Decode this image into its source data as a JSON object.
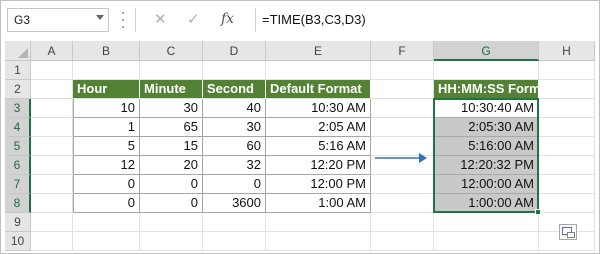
{
  "namebox": {
    "value": "G3"
  },
  "formula_bar": {
    "cancel_icon": "x-icon",
    "enter_icon": "check-icon",
    "fx_label": "fx",
    "formula": "=TIME(B3,C3,D3)"
  },
  "columns": [
    "A",
    "B",
    "C",
    "D",
    "E",
    "F",
    "G",
    "H"
  ],
  "rows": [
    "1",
    "2",
    "3",
    "4",
    "5",
    "6",
    "7",
    "8",
    "9",
    "10"
  ],
  "table1": {
    "headers": [
      "Hour",
      "Minute",
      "Second",
      "Default Format"
    ],
    "rows": [
      [
        "10",
        "30",
        "40",
        "10:30 AM"
      ],
      [
        "1",
        "65",
        "30",
        "2:05 AM"
      ],
      [
        "5",
        "15",
        "60",
        "5:16 AM"
      ],
      [
        "12",
        "20",
        "32",
        "12:20 PM"
      ],
      [
        "0",
        "0",
        "0",
        "12:00 PM"
      ],
      [
        "0",
        "0",
        "3600",
        "1:00 AM"
      ]
    ]
  },
  "table2": {
    "header": "HH:MM:SS Format",
    "values": [
      "10:30:40 AM",
      "2:05:30 AM",
      "5:16:00 AM",
      "12:20:32 PM",
      "12:00:00 AM",
      "1:00:00 AM"
    ]
  },
  "colors": {
    "header_green": "#548235",
    "selection_green": "#217346",
    "arrow_blue": "#2e75b6",
    "selection_fill": "#c9c9c9"
  }
}
